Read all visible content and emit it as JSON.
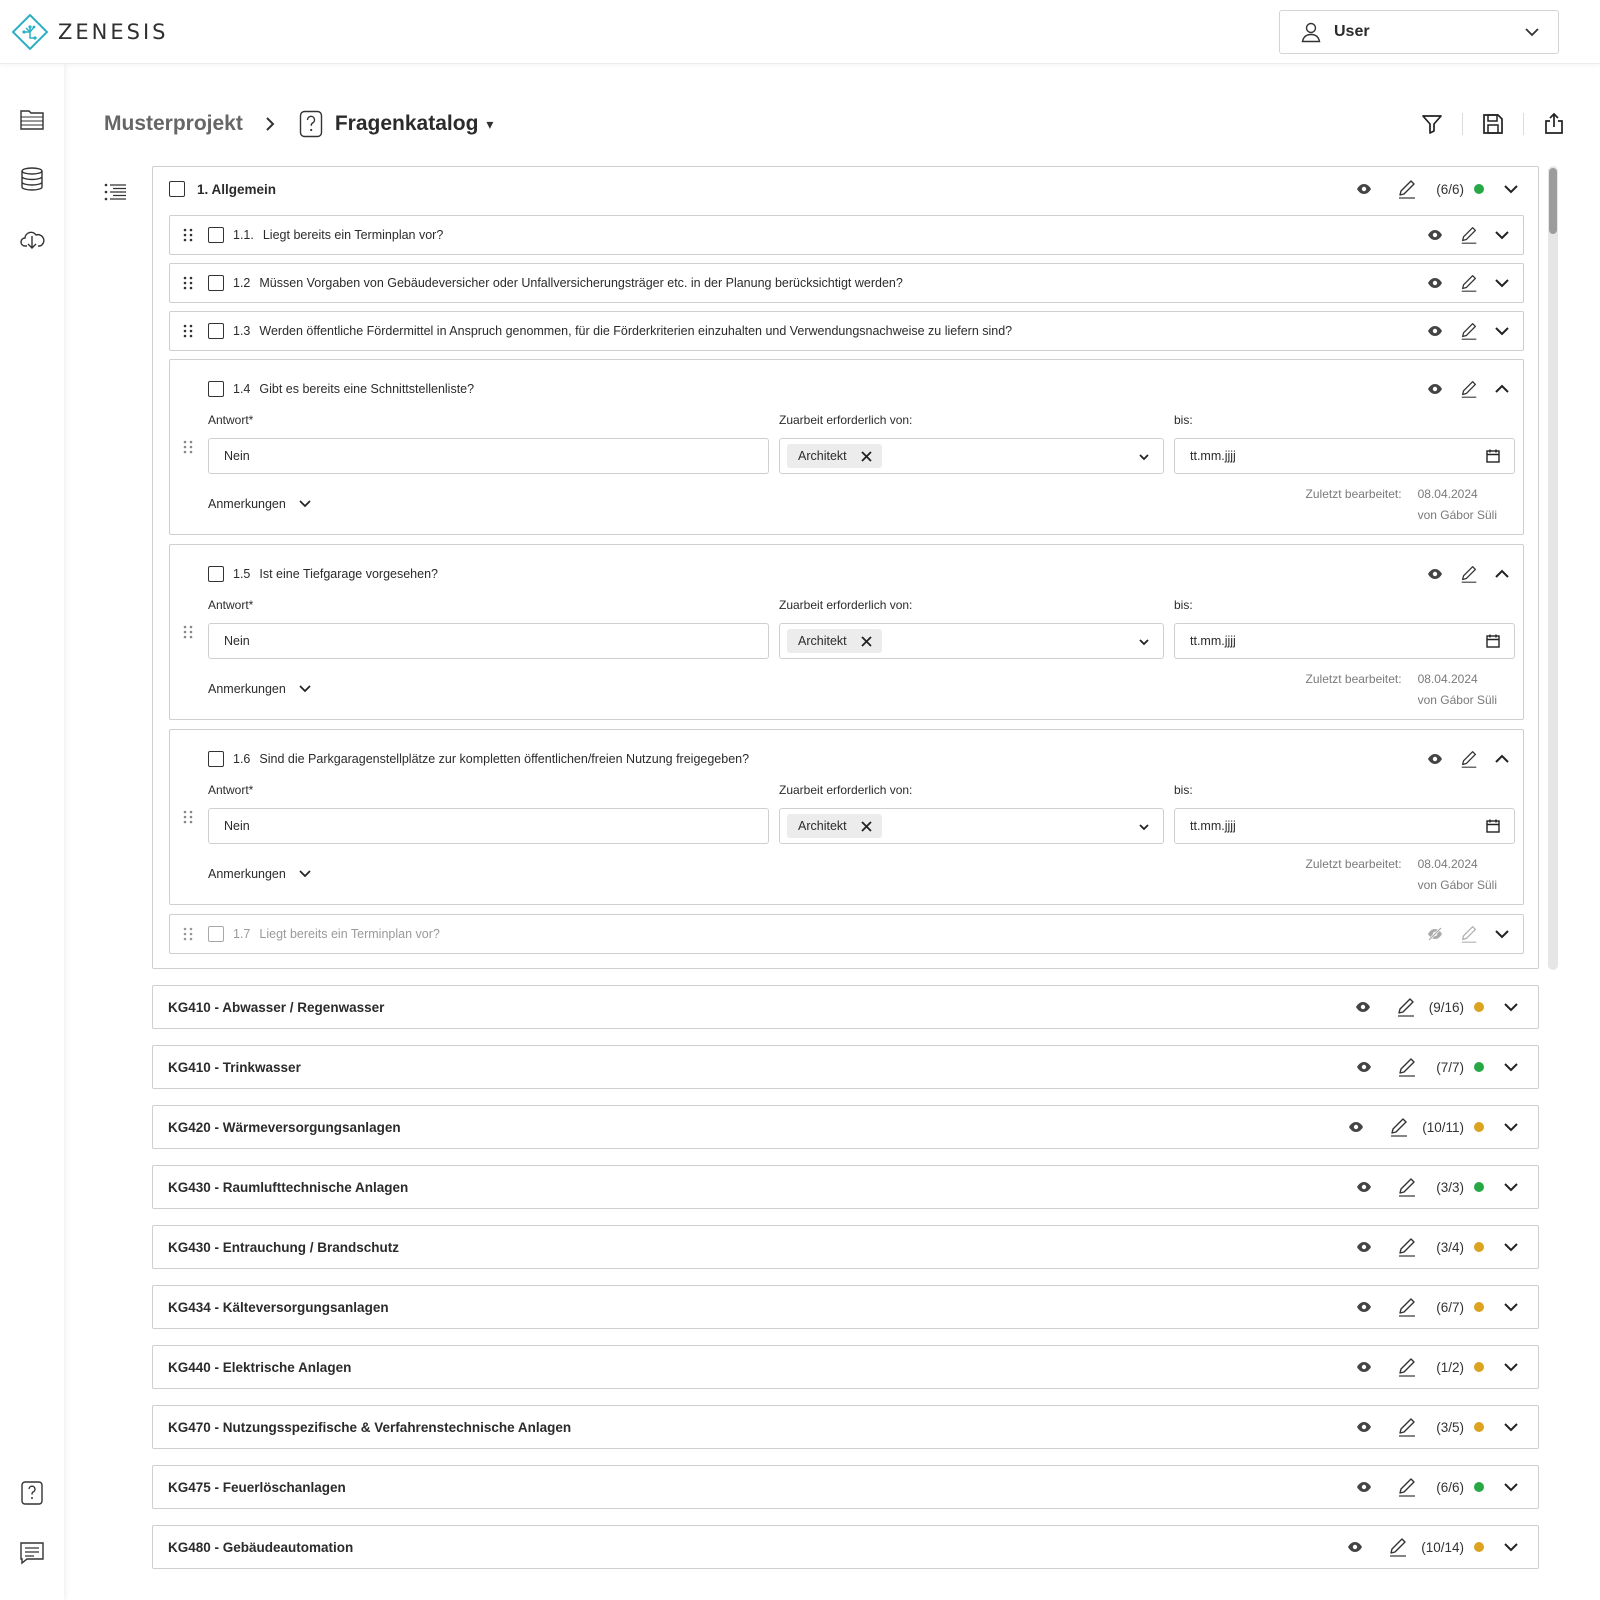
{
  "app": {
    "brand": "ZENESIS",
    "user_label": "User"
  },
  "sidebar": {
    "items": [
      {
        "name": "projects-folder-icon"
      },
      {
        "name": "database-icon"
      },
      {
        "name": "cloud-download-icon"
      },
      {
        "name": "questionnaire-icon"
      },
      {
        "name": "chat-icon"
      }
    ]
  },
  "breadcrumb": {
    "project": "Musterprojekt",
    "catalog": "Fragenkatalog",
    "caret": "▾"
  },
  "toolbar": {
    "icons": [
      "filter-icon",
      "save-icon",
      "export-icon"
    ]
  },
  "colors": {
    "complete": "#27a844",
    "partial": "#dba31f",
    "border": "#cfcfcf"
  },
  "group": {
    "title": "1. Allgemein",
    "count": "(6/6)",
    "status": "complete",
    "items": [
      {
        "num": "1.1.",
        "question": "Liegt bereits ein Terminplan vor?",
        "expanded": false,
        "visible": true
      },
      {
        "num": "1.2",
        "question": "Müssen Vorgaben von Gebäudeversicher oder Unfallversicherungsträger etc. in der Planung berücksichtigt werden?",
        "expanded": false,
        "visible": true
      },
      {
        "num": "1.3",
        "question": "Werden öffentliche Fördermittel in Anspruch genommen, für die Förderkriterien einzuhalten und Verwendungsnachweise zu liefern sind?",
        "expanded": false,
        "visible": true
      },
      {
        "num": "1.4",
        "question": "Gibt es bereits eine Schnittstellenliste?",
        "expanded": true,
        "visible": true,
        "answer_label": "Antwort*",
        "answer": "Nein",
        "zuarbeit_label": "Zuarbeit erforderlich von:",
        "zuarbeit_tag": "Architekt",
        "bis_label": "bis:",
        "date_placeholder": "tt.mm.jjjj",
        "anmerkungen": "Anmerkungen",
        "last_edited_label": "Zuletzt bearbeitet:",
        "last_edited_date": "08.04.2024",
        "last_edited_by": "von Gábor Süli"
      },
      {
        "num": "1.5",
        "question": "Ist eine Tiefgarage vorgesehen?",
        "expanded": true,
        "visible": true,
        "answer_label": "Antwort*",
        "answer": "Nein",
        "zuarbeit_label": "Zuarbeit erforderlich von:",
        "zuarbeit_tag": "Architekt",
        "bis_label": "bis:",
        "date_placeholder": "tt.mm.jjjj",
        "anmerkungen": "Anmerkungen",
        "last_edited_label": "Zuletzt bearbeitet:",
        "last_edited_date": "08.04.2024",
        "last_edited_by": "von Gábor Süli"
      },
      {
        "num": "1.6",
        "question": "Sind die Parkgaragenstellplätze zur kompletten öffentlichen/freien Nutzung freigegeben?",
        "expanded": true,
        "visible": true,
        "answer_label": "Antwort*",
        "answer": "Nein",
        "zuarbeit_label": "Zuarbeit erforderlich von:",
        "zuarbeit_tag": "Architekt",
        "bis_label": "bis:",
        "date_placeholder": "tt.mm.jjjj",
        "anmerkungen": "Anmerkungen",
        "last_edited_label": "Zuletzt bearbeitet:",
        "last_edited_date": "08.04.2024",
        "last_edited_by": "von Gábor Süli"
      },
      {
        "num": "1.7",
        "question": "Liegt bereits ein Terminplan vor?",
        "expanded": false,
        "visible": false
      }
    ]
  },
  "sections": [
    {
      "title": "KG410 - Abwasser / Regenwasser",
      "count": "(9/16)",
      "status": "partial"
    },
    {
      "title": "KG410 - Trinkwasser",
      "count": "(7/7)",
      "status": "complete"
    },
    {
      "title": "KG420 - Wärmeversorgungsanlagen",
      "count": "(10/11)",
      "status": "partial"
    },
    {
      "title": "KG430 - Raumlufttechnische Anlagen",
      "count": "(3/3)",
      "status": "complete"
    },
    {
      "title": "KG430 - Entrauchung / Brandschutz",
      "count": "(3/4)",
      "status": "partial"
    },
    {
      "title": "KG434 - Kälteversorgungsanlagen",
      "count": "(6/7)",
      "status": "partial"
    },
    {
      "title": "KG440 - Elektrische Anlagen",
      "count": "(1/2)",
      "status": "partial"
    },
    {
      "title": "KG470 - Nutzungsspezifische & Verfahrenstechnische Anlagen",
      "count": "(3/5)",
      "status": "partial"
    },
    {
      "title": "KG475 - Feuerlöschanlagen",
      "count": "(6/6)",
      "status": "complete"
    },
    {
      "title": "KG480 - Gebäudeautomation",
      "count": "(10/14)",
      "status": "partial"
    }
  ]
}
